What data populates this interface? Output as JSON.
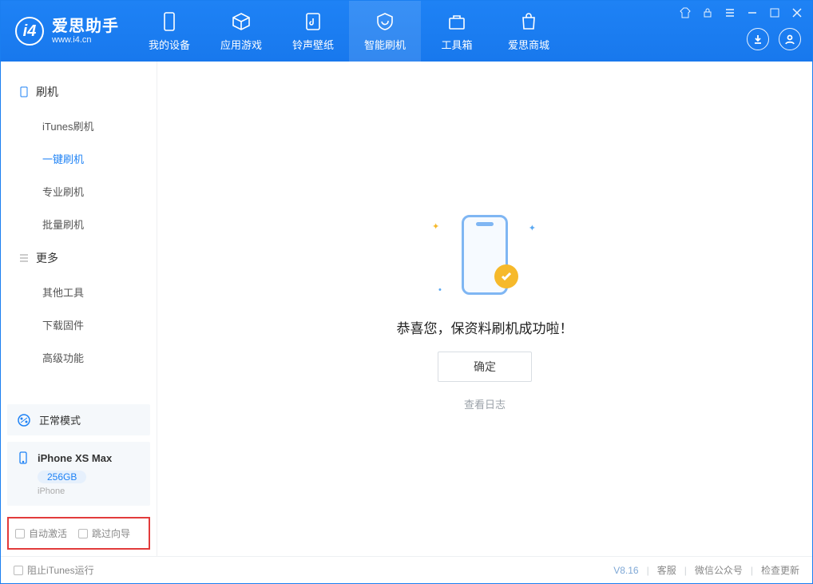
{
  "app": {
    "title": "爱思助手",
    "subtitle": "www.i4.cn"
  },
  "nav": {
    "tabs": [
      "我的设备",
      "应用游戏",
      "铃声壁纸",
      "智能刷机",
      "工具箱",
      "爱思商城"
    ],
    "active_index": 3
  },
  "sidebar": {
    "group_flash": "刷机",
    "flash_items": [
      "iTunes刷机",
      "一键刷机",
      "专业刷机",
      "批量刷机"
    ],
    "flash_active_index": 1,
    "group_more": "更多",
    "more_items": [
      "其他工具",
      "下载固件",
      "高级功能"
    ]
  },
  "device_mode": {
    "label": "正常模式"
  },
  "device": {
    "name": "iPhone XS Max",
    "capacity": "256GB",
    "type": "iPhone"
  },
  "options": {
    "auto_activate": "自动激活",
    "skip_guide": "跳过向导"
  },
  "main": {
    "success_text": "恭喜您，保资料刷机成功啦！",
    "ok_button": "确定",
    "view_log": "查看日志"
  },
  "footer": {
    "block_itunes": "阻止iTunes运行",
    "version": "V8.16",
    "customer_service": "客服",
    "wechat": "微信公众号",
    "check_update": "检查更新"
  }
}
